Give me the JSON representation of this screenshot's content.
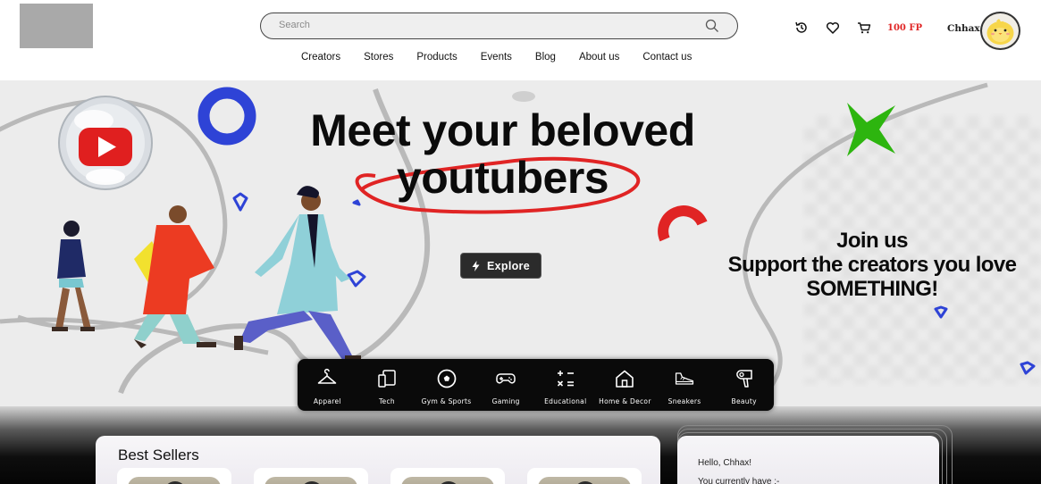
{
  "header": {
    "search_placeholder": "Search",
    "nav": [
      "Creators",
      "Stores",
      "Products",
      "Events",
      "Blog",
      "About us",
      "Contact us"
    ],
    "points": "100 FP",
    "username": "Chhax"
  },
  "hero": {
    "title_line1": "Meet your beloved",
    "title_line2": "youtubers",
    "explore_label": "Explore",
    "join_line1": "Join us",
    "join_line2": "Support the creators you love",
    "join_line3": "SOMETHING!"
  },
  "categories": [
    {
      "label": "Apparel",
      "icon": "hanger-icon"
    },
    {
      "label": "Tech",
      "icon": "devices-icon"
    },
    {
      "label": "Gym & Sports",
      "icon": "ball-icon"
    },
    {
      "label": "Gaming",
      "icon": "gamepad-icon"
    },
    {
      "label": "Educational",
      "icon": "math-icon"
    },
    {
      "label": "Home & Decor",
      "icon": "house-icon"
    },
    {
      "label": "Sneakers",
      "icon": "sneaker-icon"
    },
    {
      "label": "Beauty",
      "icon": "hairdryer-icon"
    }
  ],
  "best_sellers": {
    "title": "Best Sellers"
  },
  "wallet": {
    "greeting": "Hello, Chhax!",
    "line2": "You currently have :-"
  },
  "colors": {
    "accent_red": "#e02424",
    "hero_bg": "#ececec",
    "blue_ring": "#2e43d6",
    "green_star": "#2db50f"
  }
}
